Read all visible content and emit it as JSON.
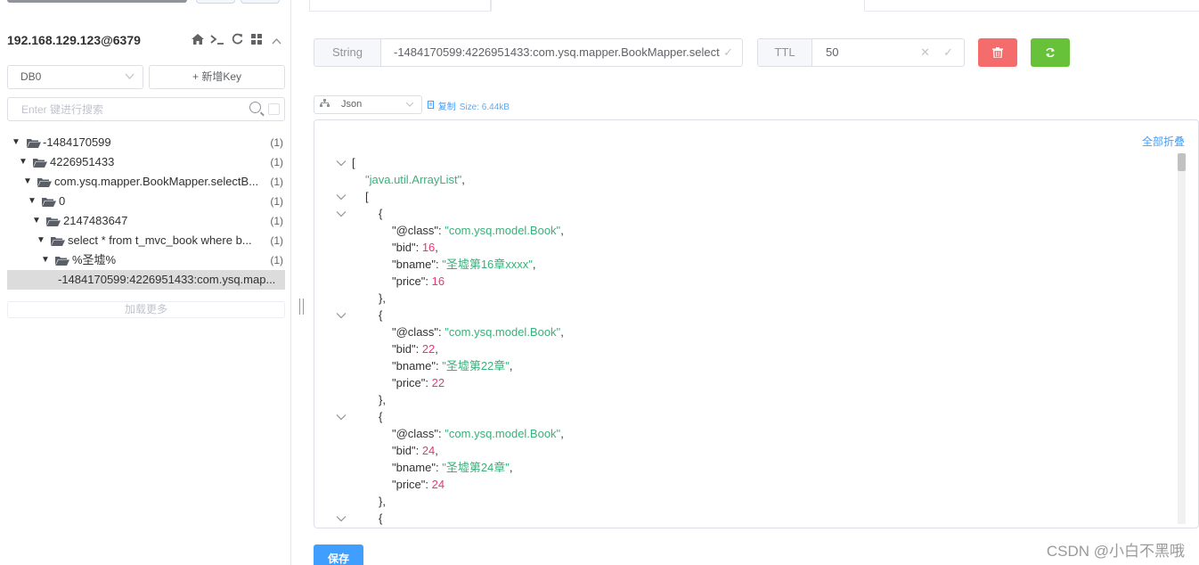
{
  "sidebar": {
    "connection": "192.168.129.123@6379",
    "db_select": "DB0",
    "new_key_label": "+ 新增Key",
    "search_placeholder": "Enter 键进行搜索",
    "tree": [
      {
        "label": "-1484170599",
        "count": "(1)"
      },
      {
        "label": "4226951433",
        "count": "(1)"
      },
      {
        "label": "com.ysq.mapper.BookMapper.selectB...",
        "count": "(1)"
      },
      {
        "label": "0",
        "count": "(1)"
      },
      {
        "label": "2147483647",
        "count": "(1)"
      },
      {
        "label": "select * from t_mvc_book where b...",
        "count": "(1)"
      },
      {
        "label": "%圣墟%",
        "count": "(1)"
      }
    ],
    "selected_leaf": "-1484170599:4226951433:com.ysq.map...",
    "load_more": "加载更多"
  },
  "key_bar": {
    "type": "String",
    "key": "-1484170599:4226951433:com.ysq.mapper.BookMapper.selectB",
    "ttl_label": "TTL",
    "ttl_value": "50"
  },
  "format": {
    "selected": "Json",
    "copy": "复制",
    "size": "Size: 6.44kB"
  },
  "viewer": {
    "collapse_all": "全部折叠",
    "lines": [
      {
        "fold": true,
        "indent": 0,
        "parts": [
          [
            "k",
            "["
          ]
        ]
      },
      {
        "fold": false,
        "indent": 1,
        "parts": [
          [
            "s",
            "\"java.util.ArrayList\""
          ],
          [
            "k",
            ","
          ]
        ]
      },
      {
        "fold": true,
        "indent": 1,
        "parts": [
          [
            "k",
            "["
          ]
        ]
      },
      {
        "fold": true,
        "indent": 2,
        "parts": [
          [
            "k",
            "{"
          ]
        ]
      },
      {
        "fold": false,
        "indent": 3,
        "parts": [
          [
            "k",
            "\"@class\": "
          ],
          [
            "s",
            "\"com.ysq.model.Book\""
          ],
          [
            "k",
            ","
          ]
        ]
      },
      {
        "fold": false,
        "indent": 3,
        "parts": [
          [
            "k",
            "\"bid\": "
          ],
          [
            "n",
            "16"
          ],
          [
            "k",
            ","
          ]
        ]
      },
      {
        "fold": false,
        "indent": 3,
        "parts": [
          [
            "k",
            "\"bname\": "
          ],
          [
            "s",
            "\"圣墟第16章xxxx\""
          ],
          [
            "k",
            ","
          ]
        ]
      },
      {
        "fold": false,
        "indent": 3,
        "parts": [
          [
            "k",
            "\"price\": "
          ],
          [
            "n",
            "16"
          ]
        ]
      },
      {
        "fold": false,
        "indent": 2,
        "parts": [
          [
            "k",
            "},"
          ]
        ]
      },
      {
        "fold": true,
        "indent": 2,
        "parts": [
          [
            "k",
            "{"
          ]
        ]
      },
      {
        "fold": false,
        "indent": 3,
        "parts": [
          [
            "k",
            "\"@class\": "
          ],
          [
            "s",
            "\"com.ysq.model.Book\""
          ],
          [
            "k",
            ","
          ]
        ]
      },
      {
        "fold": false,
        "indent": 3,
        "parts": [
          [
            "k",
            "\"bid\": "
          ],
          [
            "n",
            "22"
          ],
          [
            "k",
            ","
          ]
        ]
      },
      {
        "fold": false,
        "indent": 3,
        "parts": [
          [
            "k",
            "\"bname\": "
          ],
          [
            "s",
            "\"圣墟第22章\""
          ],
          [
            "k",
            ","
          ]
        ]
      },
      {
        "fold": false,
        "indent": 3,
        "parts": [
          [
            "k",
            "\"price\": "
          ],
          [
            "n",
            "22"
          ]
        ]
      },
      {
        "fold": false,
        "indent": 2,
        "parts": [
          [
            "k",
            "},"
          ]
        ]
      },
      {
        "fold": true,
        "indent": 2,
        "parts": [
          [
            "k",
            "{"
          ]
        ]
      },
      {
        "fold": false,
        "indent": 3,
        "parts": [
          [
            "k",
            "\"@class\": "
          ],
          [
            "s",
            "\"com.ysq.model.Book\""
          ],
          [
            "k",
            ","
          ]
        ]
      },
      {
        "fold": false,
        "indent": 3,
        "parts": [
          [
            "k",
            "\"bid\": "
          ],
          [
            "n",
            "24"
          ],
          [
            "k",
            ","
          ]
        ]
      },
      {
        "fold": false,
        "indent": 3,
        "parts": [
          [
            "k",
            "\"bname\": "
          ],
          [
            "s",
            "\"圣墟第24章\""
          ],
          [
            "k",
            ","
          ]
        ]
      },
      {
        "fold": false,
        "indent": 3,
        "parts": [
          [
            "k",
            "\"price\": "
          ],
          [
            "n",
            "24"
          ]
        ]
      },
      {
        "fold": false,
        "indent": 2,
        "parts": [
          [
            "k",
            "},"
          ]
        ]
      },
      {
        "fold": true,
        "indent": 2,
        "parts": [
          [
            "k",
            "{"
          ]
        ]
      }
    ]
  },
  "save_label": "保存",
  "watermark": "CSDN @小白不黑哦",
  "colors": {
    "primary": "#409eff",
    "danger": "#f56c6c",
    "success": "#67c23a",
    "json_string": "#3ab07a",
    "json_number": "#e8386d"
  }
}
